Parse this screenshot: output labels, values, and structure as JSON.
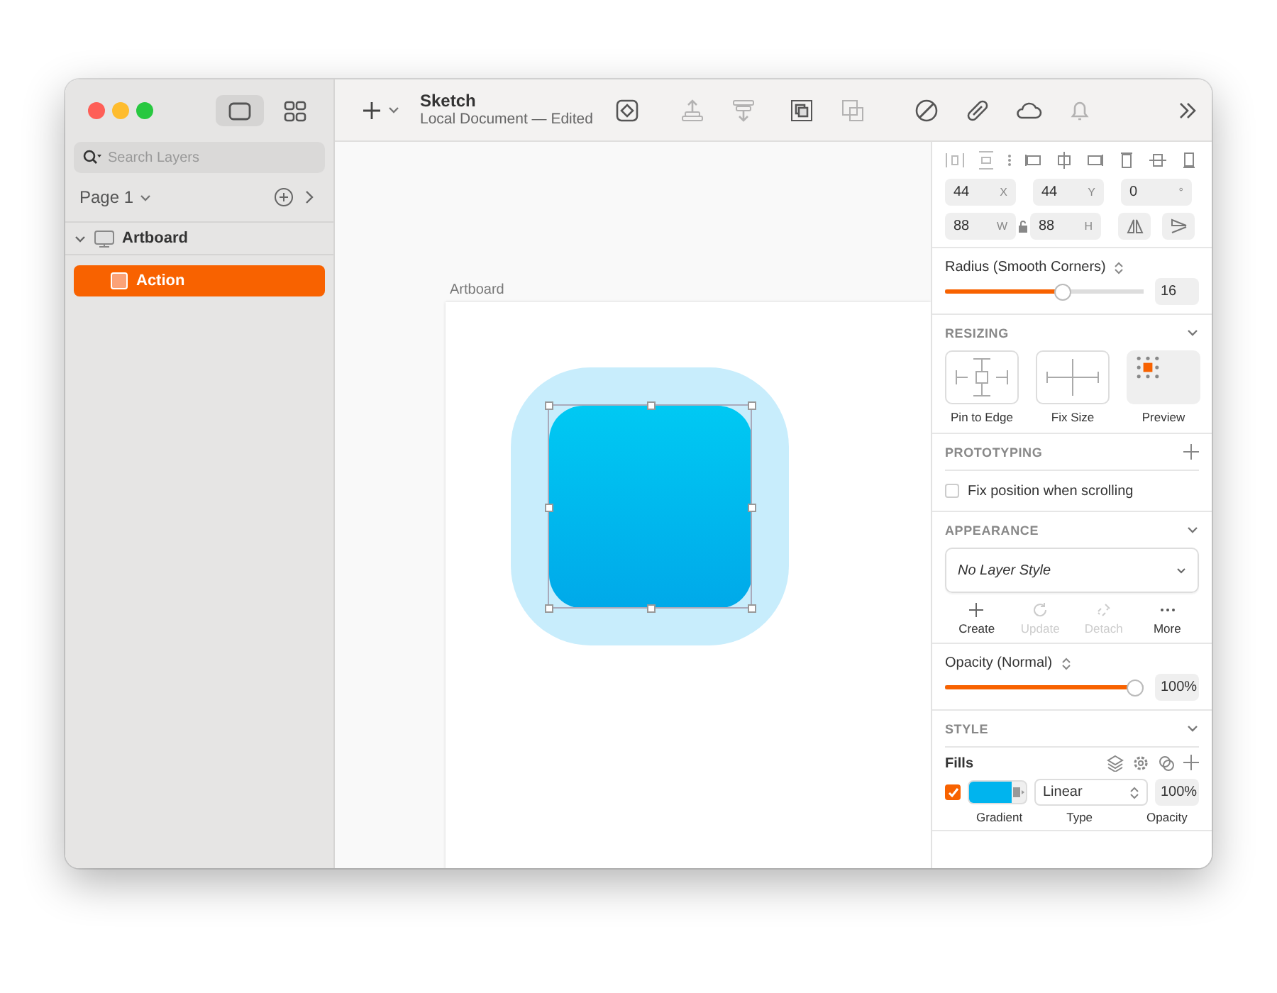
{
  "window": {
    "title": "Sketch",
    "subtitle": "Local Document — Edited"
  },
  "view_modes": [
    {
      "kind": "canvas",
      "selected": true
    },
    {
      "kind": "grid",
      "selected": false
    }
  ],
  "toolbar": [
    {
      "kind": "symbol",
      "disabled": false
    },
    {
      "kind": "forward",
      "disabled": true
    },
    {
      "kind": "backward",
      "disabled": true
    },
    {
      "kind": "mask",
      "disabled": false
    },
    {
      "kind": "scale",
      "disabled": true
    },
    {
      "kind": "edit",
      "disabled": false
    },
    {
      "kind": "link",
      "disabled": false
    },
    {
      "kind": "cloud",
      "disabled": false
    },
    {
      "kind": "bell",
      "disabled": true
    },
    {
      "kind": "more",
      "disabled": false
    }
  ],
  "sidebar": {
    "search": {
      "placeholder": "Search Layers"
    },
    "page": "Page 1",
    "layers": [
      {
        "name": "Artboard",
        "kind": "artboard",
        "expanded": true,
        "selected": false,
        "children": [
          {
            "name": "Action",
            "kind": "shape",
            "selected": true
          }
        ]
      }
    ]
  },
  "canvas": {
    "artboard_label": "Artboard"
  },
  "inspector": {
    "fields": [
      {
        "value": "44",
        "unit": "X"
      },
      {
        "value": "44",
        "unit": "Y"
      },
      {
        "value": "0",
        "unit": "°"
      },
      {
        "value": "88",
        "unit": "W"
      },
      {
        "value": "88",
        "unit": "H"
      }
    ],
    "radius": {
      "label": "Radius (Smooth Corners)",
      "level": 0.6,
      "value": "16"
    },
    "resizing": {
      "title": "RESIZING",
      "options": [
        {
          "kind": "pin",
          "label": "Pin to Edge"
        },
        {
          "kind": "fix",
          "label": "Fix Size"
        },
        {
          "kind": "preview",
          "label": "Preview"
        }
      ]
    },
    "prototyping": {
      "title": "PROTOTYPING",
      "option": {
        "label": "Fix position when scrolling",
        "checked": false
      }
    },
    "appearance": {
      "title": "APPEARANCE",
      "layer_style": "No Layer Style",
      "actions": [
        {
          "kind": "create",
          "label": "Create",
          "disabled": false
        },
        {
          "kind": "update",
          "label": "Update",
          "disabled": true
        },
        {
          "kind": "detach",
          "label": "Detach",
          "disabled": true
        },
        {
          "kind": "more",
          "label": "More",
          "disabled": false
        }
      ]
    },
    "opacity": {
      "label": "Opacity (Normal)",
      "level": 1,
      "value": "100%"
    },
    "style": {
      "title": "STYLE",
      "fills_title": "Fills",
      "fills": [
        {
          "checked": true,
          "type": "Linear",
          "opacity": "100%"
        }
      ],
      "fill_labels": [
        "Gradient",
        "Type",
        "Opacity"
      ]
    }
  }
}
